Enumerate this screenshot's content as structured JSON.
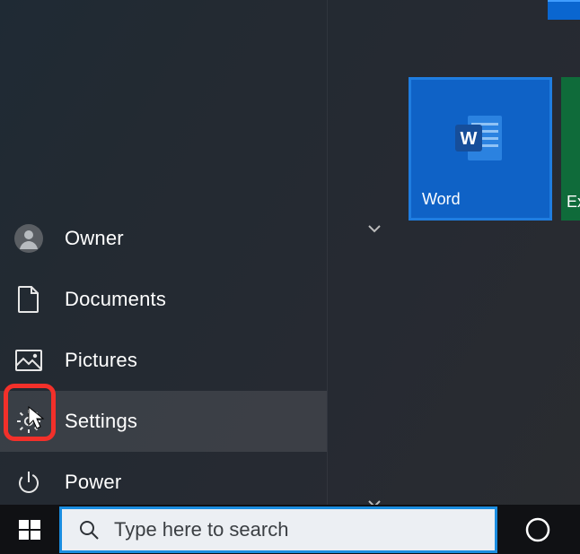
{
  "menu": {
    "items": [
      {
        "label": "Owner"
      },
      {
        "label": "Documents"
      },
      {
        "label": "Pictures"
      },
      {
        "label": "Settings"
      },
      {
        "label": "Power"
      }
    ]
  },
  "tiles": {
    "word": {
      "label": "Word"
    },
    "excel": {
      "label": "Exc"
    }
  },
  "taskbar": {
    "search_placeholder": "Type here to search"
  }
}
